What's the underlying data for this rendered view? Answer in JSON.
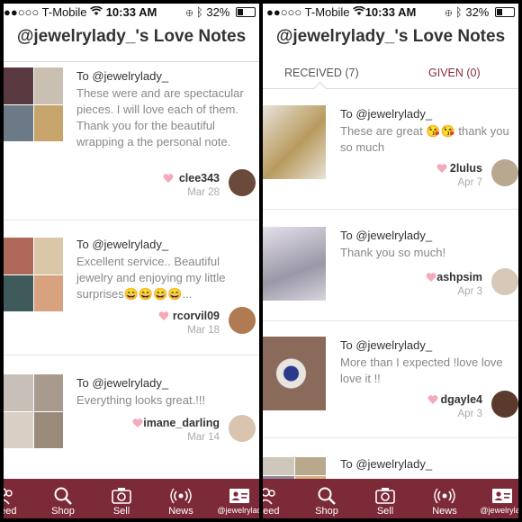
{
  "status_bar": {
    "carrier": "T-Mobile",
    "time": "10:33 AM",
    "battery": "32%",
    "battery_level": 0.32
  },
  "title": "@jewelrylady_'s Love Notes",
  "tabs": {
    "received": "RECEIVED (7)",
    "given": "GIVEN (0)"
  },
  "colors": {
    "brand": "#7d2a38",
    "heart": "#f4aab8",
    "date": "#aaaaaa"
  },
  "left_notes": [
    {
      "to": "To @jewelrylady_",
      "message": "These were and are spectacular pieces. I will love each of them. Thank you for the beautiful wrapping a the personal note.",
      "user": "clee343",
      "date": "Mar 28"
    },
    {
      "to": "To @jewelrylady_",
      "message": "Excellent service.. Beautiful jewelry and enjoying my little surprises😄😄😄😄...",
      "user": "rcorvil09",
      "date": "Mar 18"
    },
    {
      "to": "To @jewelrylady_",
      "message": "Everything looks great.!!!",
      "user": "imane_darling",
      "date": "Mar 14"
    }
  ],
  "right_notes": [
    {
      "to": "To @jewelrylady_",
      "message": "These are great 😘😘 thank you so much",
      "user": "2lulus",
      "date": "Apr 7"
    },
    {
      "to": "To @jewelrylady_",
      "message": "Thank you so much!",
      "user": "ashpsim",
      "date": "Apr 3"
    },
    {
      "to": "To @jewelrylady_",
      "message": "More than I expected !love love love it !!",
      "user": "dgayle4",
      "date": "Apr 3"
    },
    {
      "to": "To @jewelrylady_"
    }
  ],
  "nav": {
    "feed": "Feed",
    "shop": "Shop",
    "sell": "Sell",
    "news": "News",
    "profile": "@jewelrylad"
  }
}
